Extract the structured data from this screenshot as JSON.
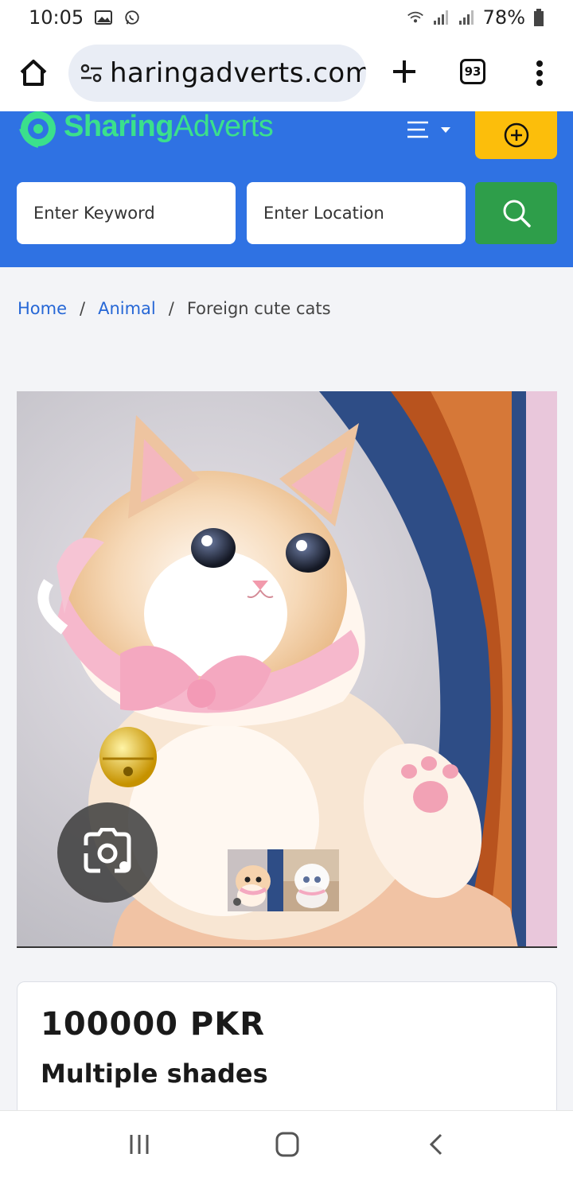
{
  "status_bar": {
    "time": "10:05",
    "battery": "78%",
    "icons": [
      "gallery-icon",
      "whatsapp-icon",
      "wifi-icon",
      "signal-icon",
      "signal-icon",
      "battery-icon"
    ]
  },
  "browser": {
    "url": "haringadverts.com",
    "tab_count": "93",
    "icons": [
      "home-icon",
      "site-settings-icon",
      "new-tab-icon",
      "menu-icon"
    ]
  },
  "site": {
    "logo_part1": "Sharing",
    "logo_part2": "Adverts",
    "keyword_placeholder": "Enter Keyword",
    "location_placeholder": "Enter Location",
    "colors": {
      "header": "#2f72e3",
      "add": "#fcbe0b",
      "search": "#2e9e4a",
      "logo": "#3be08c"
    }
  },
  "breadcrumb": {
    "items": [
      "Home",
      "Animal"
    ],
    "current": "Foreign cute cats"
  },
  "listing": {
    "price": "100000 PKR",
    "subtitle": "Multiple shades"
  },
  "navbar": {
    "icons": [
      "recent-apps-icon",
      "home-nav-icon",
      "back-icon"
    ]
  }
}
